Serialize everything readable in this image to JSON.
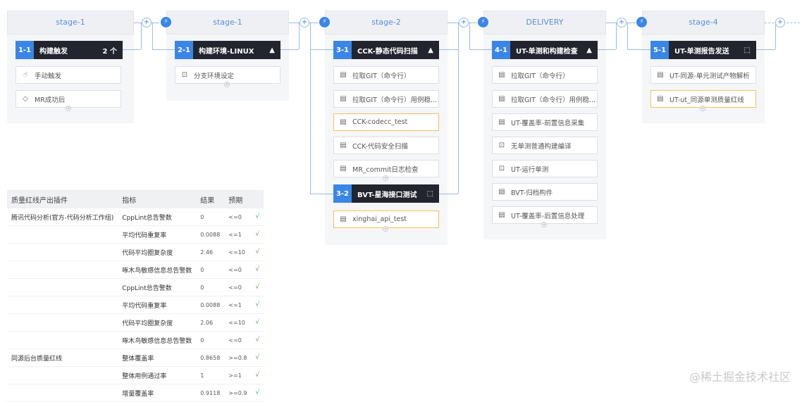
{
  "stages": [
    {
      "header": "stage-1"
    },
    {
      "header": "stage-1"
    },
    {
      "header": "stage-2"
    },
    {
      "header": "DELIVERY"
    },
    {
      "header": "stage-4"
    }
  ],
  "jobs": [
    {
      "num": "1-1",
      "title": "构建触发",
      "tail": "2 个"
    },
    {
      "num": "2-1",
      "title": "构建环境-LINUX",
      "tail": "linux-icon"
    },
    {
      "num": "3-1",
      "title": "CCK-静态代码扫描",
      "tail": "linux-icon"
    },
    {
      "num": "3-2",
      "title": "BVT-星海接口测试",
      "tail": "select-icon"
    },
    {
      "num": "4-1",
      "title": "UT-单测和构建检查",
      "tail": "linux-icon"
    },
    {
      "num": "5-1",
      "title": "UT-单测报告发送",
      "tail": "select-icon"
    }
  ],
  "tasks": {
    "s1": [
      "手动触发",
      "MR成功后"
    ],
    "s2": [
      "分支环境设定"
    ],
    "s3a": [
      "拉取GIT（命令行）",
      "拉取GIT（命令行）用例稳...",
      "CCK-codecc_test",
      "CCK-代码安全扫描",
      "MR_commit日志检查"
    ],
    "s3b": [
      "xinghai_api_test"
    ],
    "s4": [
      "拉取GIT（命令行）",
      "拉取GIT（命令行）用例稳...",
      "UT-覆盖率-前置信息采集",
      "无单测普通构建编译",
      "UT-运行单测",
      "BVT-归档构件",
      "UT-覆盖率-后置信息处理"
    ],
    "s5": [
      "UT-同源-单元测试产物解析",
      "UT-ut_同源单测质量红线"
    ]
  },
  "table": {
    "headers": [
      "质量红线产出插件",
      "指标",
      "结果",
      "预期",
      ""
    ],
    "rows": [
      [
        "腾讯代码分析(官方-代码分析工作组)",
        "CppLint总告警数",
        "0",
        "<=0",
        "√"
      ],
      [
        "",
        "平均代码重复率",
        "0.0088",
        "<=1",
        "√"
      ],
      [
        "",
        "代码平均圈复杂度",
        "2.46",
        "<=10",
        "√"
      ],
      [
        "",
        "啄木鸟敏感信息总告警数",
        "0",
        "<=0",
        "√"
      ],
      [
        "",
        "CppLint总告警数",
        "0",
        "<=0",
        "√"
      ],
      [
        "",
        "平均代码重复率",
        "0.0088",
        "<=1",
        "√"
      ],
      [
        "",
        "代码平均圈复杂度",
        "2.06",
        "<=10",
        "√"
      ],
      [
        "",
        "啄木鸟敏感信息总告警数",
        "0",
        "<=0",
        "√"
      ],
      [
        "同源后台质量红线",
        "整体覆盖率",
        "0.8658",
        ">=0.8",
        "√"
      ],
      [
        "",
        "整体用例通过率",
        "1",
        ">=1",
        "√"
      ],
      [
        "",
        "增量覆盖率",
        "0.9118",
        ">=0.9",
        "√"
      ]
    ]
  },
  "watermark": "@稀土掘金技术社区",
  "colors": {
    "accent": "#3a86e8",
    "job_bg": "#22252e",
    "warn_border": "#f2c35a",
    "ok": "#4caf50"
  }
}
